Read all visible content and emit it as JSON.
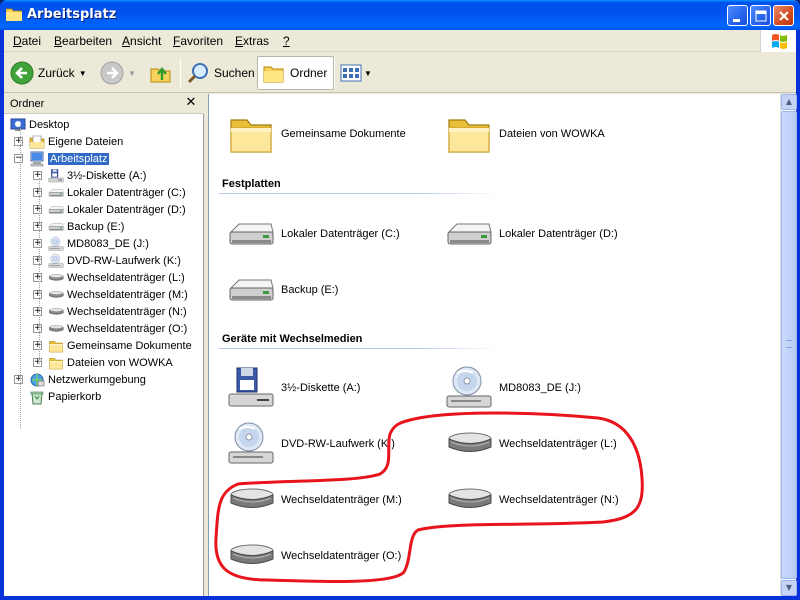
{
  "window": {
    "title": "Arbeitsplatz"
  },
  "menu": {
    "items": [
      {
        "label": "Datei",
        "accel": "D",
        "rest": "atei"
      },
      {
        "label": "Bearbeiten",
        "accel": "B",
        "rest": "earbeiten"
      },
      {
        "label": "Ansicht",
        "accel": "A",
        "rest": "nsicht"
      },
      {
        "label": "Favoriten",
        "accel": "F",
        "rest": "avoriten"
      },
      {
        "label": "Extras",
        "accel": "E",
        "rest": "xtras"
      },
      {
        "label": "?",
        "accel": "?",
        "rest": ""
      }
    ]
  },
  "toolbar": {
    "back_label": "Zurück",
    "search_label": "Suchen",
    "folders_label": "Ordner"
  },
  "folder_pane": {
    "title": "Ordner",
    "close_glyph": "✕",
    "tree": [
      {
        "label": "Desktop",
        "icon": "desktop-icon",
        "expander": ""
      },
      {
        "label": "Eigene Dateien",
        "icon": "my-documents-icon",
        "expander": "+"
      },
      {
        "label": "Arbeitsplatz",
        "icon": "my-computer-icon",
        "expander": "−",
        "selected": true
      },
      {
        "label": "3½-Diskette (A:)",
        "icon": "floppy-drive-icon",
        "expander": "+"
      },
      {
        "label": "Lokaler Datenträger (C:)",
        "icon": "hard-drive-icon",
        "expander": "+"
      },
      {
        "label": "Lokaler Datenträger (D:)",
        "icon": "hard-drive-icon",
        "expander": "+"
      },
      {
        "label": "Backup (E:)",
        "icon": "hard-drive-icon",
        "expander": "+"
      },
      {
        "label": "MD8083_DE (J:)",
        "icon": "cd-drive-icon",
        "expander": "+"
      },
      {
        "label": "DVD-RW-Laufwerk (K:)",
        "icon": "cd-drive-icon",
        "expander": "+"
      },
      {
        "label": "Wechseldatenträger (L:)",
        "icon": "removable-drive-icon",
        "expander": "+"
      },
      {
        "label": "Wechseldatenträger (M:)",
        "icon": "removable-drive-icon",
        "expander": "+"
      },
      {
        "label": "Wechseldatenträger (N:)",
        "icon": "removable-drive-icon",
        "expander": "+"
      },
      {
        "label": "Wechseldatenträger (O:)",
        "icon": "removable-drive-icon",
        "expander": "+"
      },
      {
        "label": "Gemeinsame Dokumente",
        "icon": "folder-icon",
        "expander": "+"
      },
      {
        "label": "Dateien von WOWKA",
        "icon": "folder-icon",
        "expander": "+"
      },
      {
        "label": "Netzwerkumgebung",
        "icon": "network-icon",
        "expander": "+"
      },
      {
        "label": "Papierkorb",
        "icon": "recycle-bin-icon",
        "expander": ""
      }
    ]
  },
  "content": {
    "folders": [
      {
        "label": "Gemeinsame Dokumente",
        "icon": "folder-icon"
      },
      {
        "label": "Dateien von WOWKA",
        "icon": "folder-icon"
      }
    ],
    "group_hdd": "Festplatten",
    "hdd": [
      {
        "label": "Lokaler Datenträger (C:)",
        "icon": "hard-drive-icon"
      },
      {
        "label": "Lokaler Datenträger (D:)",
        "icon": "hard-drive-icon"
      },
      {
        "label": "Backup (E:)",
        "icon": "hard-drive-icon"
      }
    ],
    "group_removable": "Geräte mit Wechselmedien",
    "removable": [
      {
        "label": "3½-Diskette (A:)",
        "icon": "floppy-drive-icon"
      },
      {
        "label": "MD8083_DE (J:)",
        "icon": "cd-drive-icon"
      },
      {
        "label": "DVD-RW-Laufwerk (K:)",
        "icon": "cd-drive-icon"
      },
      {
        "label": "Wechseldatenträger (L:)",
        "icon": "removable-drive-icon"
      },
      {
        "label": "Wechseldatenträger (M:)",
        "icon": "removable-drive-icon"
      },
      {
        "label": "Wechseldatenträger (N:)",
        "icon": "removable-drive-icon"
      },
      {
        "label": "Wechseldatenträger (O:)",
        "icon": "removable-drive-icon"
      }
    ]
  },
  "colors": {
    "titlebar": "#0054e3",
    "selection": "#316ac5",
    "annotation": "#e8141b"
  }
}
